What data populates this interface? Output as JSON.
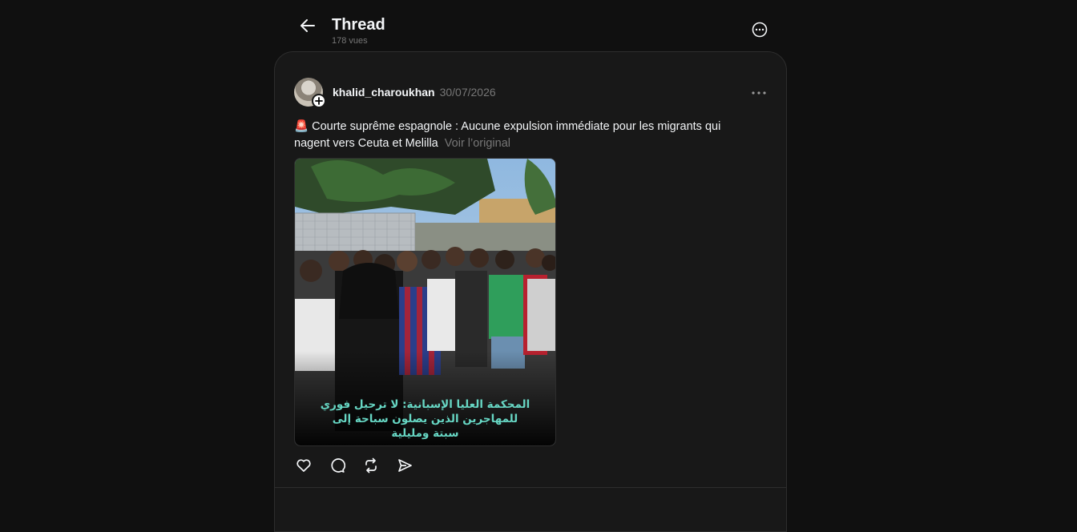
{
  "header": {
    "title": "Thread",
    "views": "178 vues"
  },
  "post": {
    "username": "khalid_charoukhan",
    "date": "30/07/2026",
    "emoji": "🚨",
    "text": "Courte suprême espagnole : Aucune expulsion immédiate pour les migrants qui nagent vers Ceuta et Melilla",
    "see_original": "Voir l’original",
    "media": {
      "caption_lines": [
        "المحكمة العليا الإسبانية: لا ترحيل فوري",
        "للمهاجرين الذين يصلون سباحة إلى",
        "سبتة ومليلية"
      ]
    }
  },
  "icons": {
    "back": "arrow-left-icon",
    "more": "more-circle-icon",
    "post_more": "ellipsis-icon",
    "follow": "plus-icon",
    "like": "heart-icon",
    "reply": "comment-icon",
    "repost": "repost-icon",
    "share": "send-icon"
  },
  "colors": {
    "background": "#101010",
    "card": "#181818",
    "border": "#2d2d2d",
    "text": "#f3f5f7",
    "muted": "#777777",
    "caption": "#67d7c4"
  }
}
